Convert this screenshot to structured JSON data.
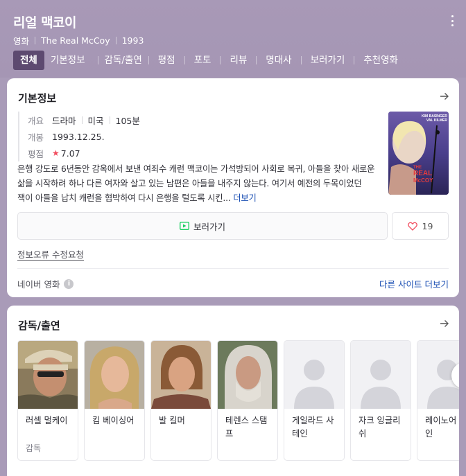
{
  "header": {
    "title": "리얼 맥코이",
    "meta": [
      "영화",
      "The Real McCoy",
      "1993"
    ]
  },
  "tabs": [
    {
      "label": "전체",
      "active": true
    },
    {
      "label": "기본정보"
    },
    {
      "label": "감독/출연"
    },
    {
      "label": "평점"
    },
    {
      "label": "포토"
    },
    {
      "label": "리뷰"
    },
    {
      "label": "명대사"
    },
    {
      "label": "보러가기"
    },
    {
      "label": "추천영화"
    }
  ],
  "basic": {
    "title": "기본정보",
    "overview_label": "개요",
    "overview": [
      "드라마",
      "미국",
      "105분"
    ],
    "release_label": "개봉",
    "release": "1993.12.25.",
    "rating_label": "평점",
    "rating": "7.07",
    "poster_text": {
      "cast1": "KIM BASINGER",
      "cast2": "VAL KILMER",
      "title1": "THE",
      "title2": "REAL",
      "title3": "McCOY"
    },
    "synopsis": "은행 강도로 6년동안 감옥에서 보낸 여죄수 캐런 맥코이는 가석방되어 사회로 복귀, 아들을 찾아 새로운 삶을 시작하려 하나 다른 여자와 살고 있는 남편은 아들을 내주지 않는다. 여기서 예전의 두목이었던 잭이 아들을 납치 캐런을 협박하여 다시 은행을 털도록 시킨...",
    "more": "더보기",
    "watch_label": "보러가기",
    "like_count": "19",
    "report": "정보오류 수정요청",
    "source": "네이버 영화",
    "other_sites": "다른 사이트 더보기"
  },
  "cast": {
    "title": "감독/출연",
    "people": [
      {
        "name": "러셀 멀케이",
        "role": "감독",
        "photo": "director"
      },
      {
        "name": "킴 베이싱어",
        "role": "",
        "photo": "blonde"
      },
      {
        "name": "발 킬머",
        "role": "",
        "photo": "man"
      },
      {
        "name": "테렌스 스탬프",
        "role": "",
        "photo": "old"
      },
      {
        "name": "게일라드 사테인",
        "role": "",
        "photo": "none"
      },
      {
        "name": "자크 잉글리쉬",
        "role": "",
        "photo": "none"
      },
      {
        "name": "레이노어 샤인",
        "role": "",
        "photo": "none"
      }
    ]
  },
  "colors": {
    "header_bg": "#a899b7",
    "active_tab": "#5d4a70",
    "link": "#1b4fb3",
    "star": "#f14b5d",
    "watch_icon": "#19ce60"
  }
}
